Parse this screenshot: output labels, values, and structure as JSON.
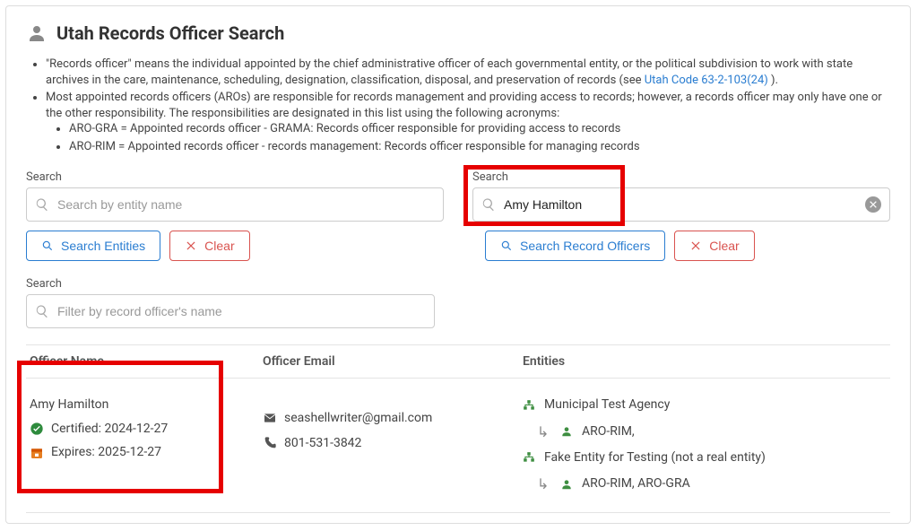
{
  "page_title": "Utah Records Officer Search",
  "intro": {
    "para1_prefix": "\"Records officer\" means the individual appointed by the chief administrative officer of each governmental entity, or the political subdivision to work with state archives in the care, maintenance, scheduling, designation, classification, disposal, and preservation of records (see ",
    "para1_link": "Utah Code 63-2-103(24)",
    "para1_suffix": ").",
    "para2": "Most appointed records officers (AROs) are responsible for records management and providing access to records; however, a records officer may only have one or the other responsibility. The responsibilities are designated in this list using the following acronyms:",
    "sub1": "ARO-GRA = Appointed records officer - GRAMA: Records officer responsible for providing access to records",
    "sub2": "ARO-RIM = Appointed records officer - records management: Records officer responsible for managing records"
  },
  "search_left": {
    "label": "Search",
    "placeholder": "Search by entity name",
    "value": "",
    "search_btn": "Search Entities",
    "clear_btn": "Clear"
  },
  "search_right": {
    "label": "Search",
    "value": "Amy Hamilton",
    "search_btn": "Search Record Officers",
    "clear_btn": "Clear"
  },
  "filter": {
    "label": "Search",
    "placeholder": "Filter by record officer's name",
    "value": ""
  },
  "table": {
    "headers": {
      "name": "Officer Name",
      "email": "Officer Email",
      "entities": "Entities"
    },
    "rows": [
      {
        "name": "Amy Hamilton",
        "certified_label": "Certified: 2024-12-27",
        "expires_label": "Expires: 2025-12-27",
        "email": "seashellwriter@gmail.com",
        "phone": "801-531-3842",
        "entities": [
          {
            "name": "Municipal Test Agency",
            "roles": "ARO-RIM,"
          },
          {
            "name": "Fake Entity for Testing (not a real entity)",
            "roles": "ARO-RIM, ARO-GRA"
          }
        ]
      }
    ]
  }
}
